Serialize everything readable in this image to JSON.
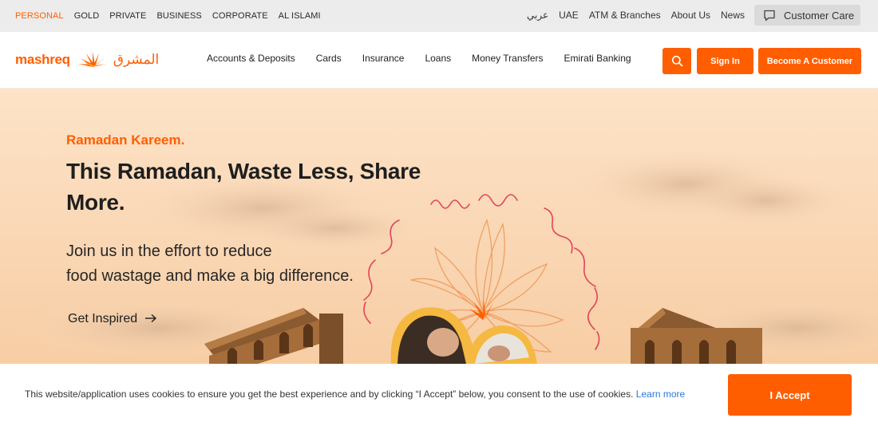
{
  "topbar": {
    "segments": [
      "PERSONAL",
      "GOLD",
      "PRIVATE",
      "BUSINESS",
      "CORPORATE",
      "AL ISLAMI"
    ],
    "active_segment": "PERSONAL",
    "utility_links": [
      "عربي",
      "UAE",
      "ATM & Branches",
      "About Us",
      "News"
    ],
    "customer_care": "Customer Care"
  },
  "header": {
    "logo_en": "mashreq",
    "logo_ar": "المشرق",
    "nav": [
      "Accounts & Deposits",
      "Cards",
      "Insurance",
      "Loans",
      "Money Transfers",
      "Emirati Banking"
    ],
    "signin": "Sign In",
    "become_customer": "Become A Customer"
  },
  "hero": {
    "eyebrow": "Ramadan Kareem.",
    "headline": "This Ramadan, Waste Less, Share More.",
    "subline_1": "Join us in the effort to reduce",
    "subline_2": "food wastage and make a big difference.",
    "cta": "Get Inspired"
  },
  "cookie": {
    "text": "This website/application uses cookies to ensure you get the best experience and by clicking “I Accept” below, you consent to the use of cookies.",
    "link": "Learn more",
    "accept": "I Accept"
  },
  "colors": {
    "accent": "#ff5e00",
    "hero_bg": "#fbdcbb",
    "topbar_bg": "#ececec",
    "link_blue": "#2b79d9"
  },
  "icons": [
    "chat-bubble-icon",
    "mashreq-sun-logo-icon",
    "search-icon",
    "arrow-right-icon"
  ]
}
